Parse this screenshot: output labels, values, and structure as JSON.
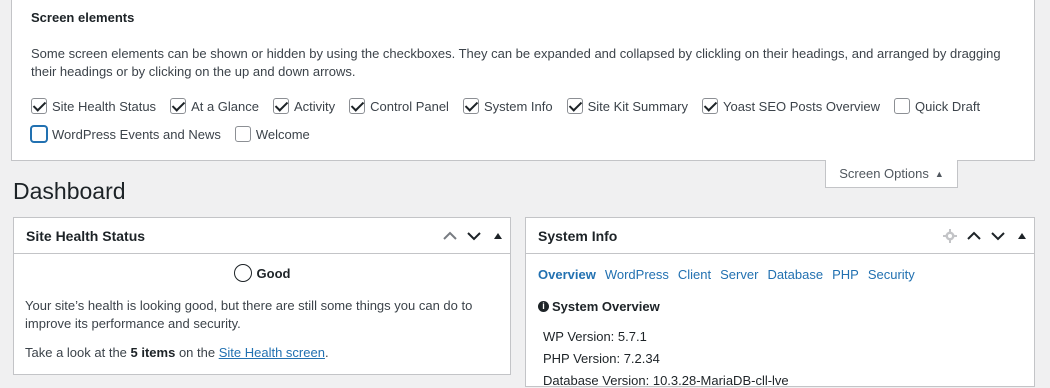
{
  "screen_options": {
    "legend": "Screen elements",
    "description": "Some screen elements can be shown or hidden by using the checkboxes. They can be expanded and collapsed by clickling on their headings, and arranged by dragging their headings or by clicking on the up and down arrows.",
    "checkboxes": [
      {
        "label": "Site Health Status",
        "checked": true
      },
      {
        "label": "At a Glance",
        "checked": true
      },
      {
        "label": "Activity",
        "checked": true
      },
      {
        "label": "Control Panel",
        "checked": true
      },
      {
        "label": "System Info",
        "checked": true
      },
      {
        "label": "Site Kit Summary",
        "checked": true
      },
      {
        "label": "Yoast SEO Posts Overview",
        "checked": true
      },
      {
        "label": "Quick Draft",
        "checked": false
      },
      {
        "label": "WordPress Events and News",
        "checked": false
      },
      {
        "label": "Welcome",
        "checked": false
      }
    ],
    "toggle_label": "Screen Options"
  },
  "page": {
    "title": "Dashboard"
  },
  "site_health": {
    "title": "Site Health Status",
    "status": "Good",
    "description": "Your site’s health is looking good, but there are still some things you can do to improve its performance and security.",
    "foot_prefix": "Take a look at the ",
    "foot_bold": "5 items",
    "foot_mid": " on the ",
    "foot_link": "Site Health screen",
    "foot_suffix": "."
  },
  "system_info": {
    "title": "System Info",
    "tabs": [
      "Overview",
      "WordPress",
      "Client",
      "Server",
      "Database",
      "PHP",
      "Security"
    ],
    "section_title": "System Overview",
    "lines": [
      "WP Version: 5.7.1",
      "PHP Version: 7.2.34",
      "Database Version: 10.3.28-MariaDB-cll-lve"
    ]
  },
  "colors": {
    "link": "#2271b1",
    "background": "#f0f0f1",
    "border": "#c3c4c7"
  }
}
